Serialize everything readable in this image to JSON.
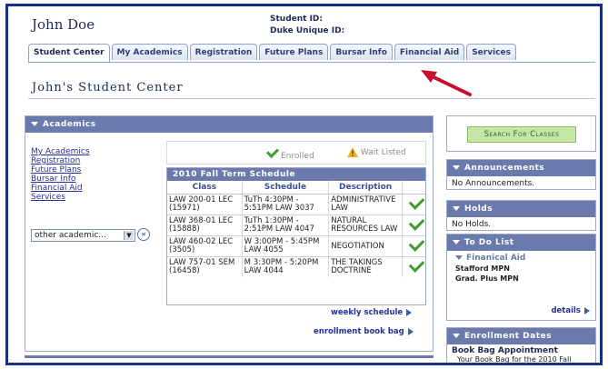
{
  "student": {
    "name": "John Doe",
    "id_label": "Student ID:",
    "duke_label": "Duke Unique ID:"
  },
  "tabs": [
    "Student Center",
    "My Academics",
    "Registration",
    "Future Plans",
    "Bursar Info",
    "Financial Aid",
    "Services"
  ],
  "page_title": "John's Student Center",
  "academics": {
    "header": "Academics",
    "links": [
      "My Academics",
      "Registration",
      "Future Plans",
      "Bursar Info",
      "Financial Aid",
      "Services"
    ],
    "select_value": "other academic...",
    "go_label": "»",
    "legend": {
      "enrolled": "Enrolled",
      "waitlisted": "Wait Listed"
    },
    "schedule": {
      "title": "2010 Fall Term Schedule",
      "columns": [
        "Class",
        "Schedule",
        "Description"
      ],
      "rows": [
        {
          "class": "LAW 200-01 LEC (15971)",
          "schedule": "TuTh 4:30PM - 5:51PM LAW 3037",
          "description": "ADMINISTRATIVE LAW"
        },
        {
          "class": "LAW 368-01 LEC (15888)",
          "schedule": "TuTh 1:30PM - 2:51PM LAW 4047",
          "description": "NATURAL RESOURCES LAW"
        },
        {
          "class": "LAW 460-02 LEC (3505)",
          "schedule": "W 3:00PM - 5:45PM LAW 4055",
          "description": "NEGOTIATION"
        },
        {
          "class": "LAW 757-01 SEM (16458)",
          "schedule": "M 3:30PM - 5:20PM LAW 4044",
          "description": "THE TAKINGS DOCTRINE"
        }
      ]
    },
    "weekly_schedule": "weekly schedule",
    "book_bag": "enrollment book bag"
  },
  "search_button": "Search For Classes",
  "announcements": {
    "header": "Announcements",
    "text": "No Announcements."
  },
  "holds": {
    "header": "Holds",
    "text": "No Holds."
  },
  "todo": {
    "header": "To Do List",
    "group": "Finanical Aid",
    "items": [
      "Stafford MPN",
      "Grad. Plus MPN"
    ],
    "details": "details"
  },
  "enrollment_dates": {
    "header": "Enrollment Dates",
    "subheader": "Book Bag Appointment",
    "text": "Your Book Bag for the 2010 Fall"
  },
  "colors": {
    "header_bg": "#6b7aac",
    "frame": "#1a2f86",
    "check": "#3e9d2b",
    "arrow": "#c8102e"
  }
}
